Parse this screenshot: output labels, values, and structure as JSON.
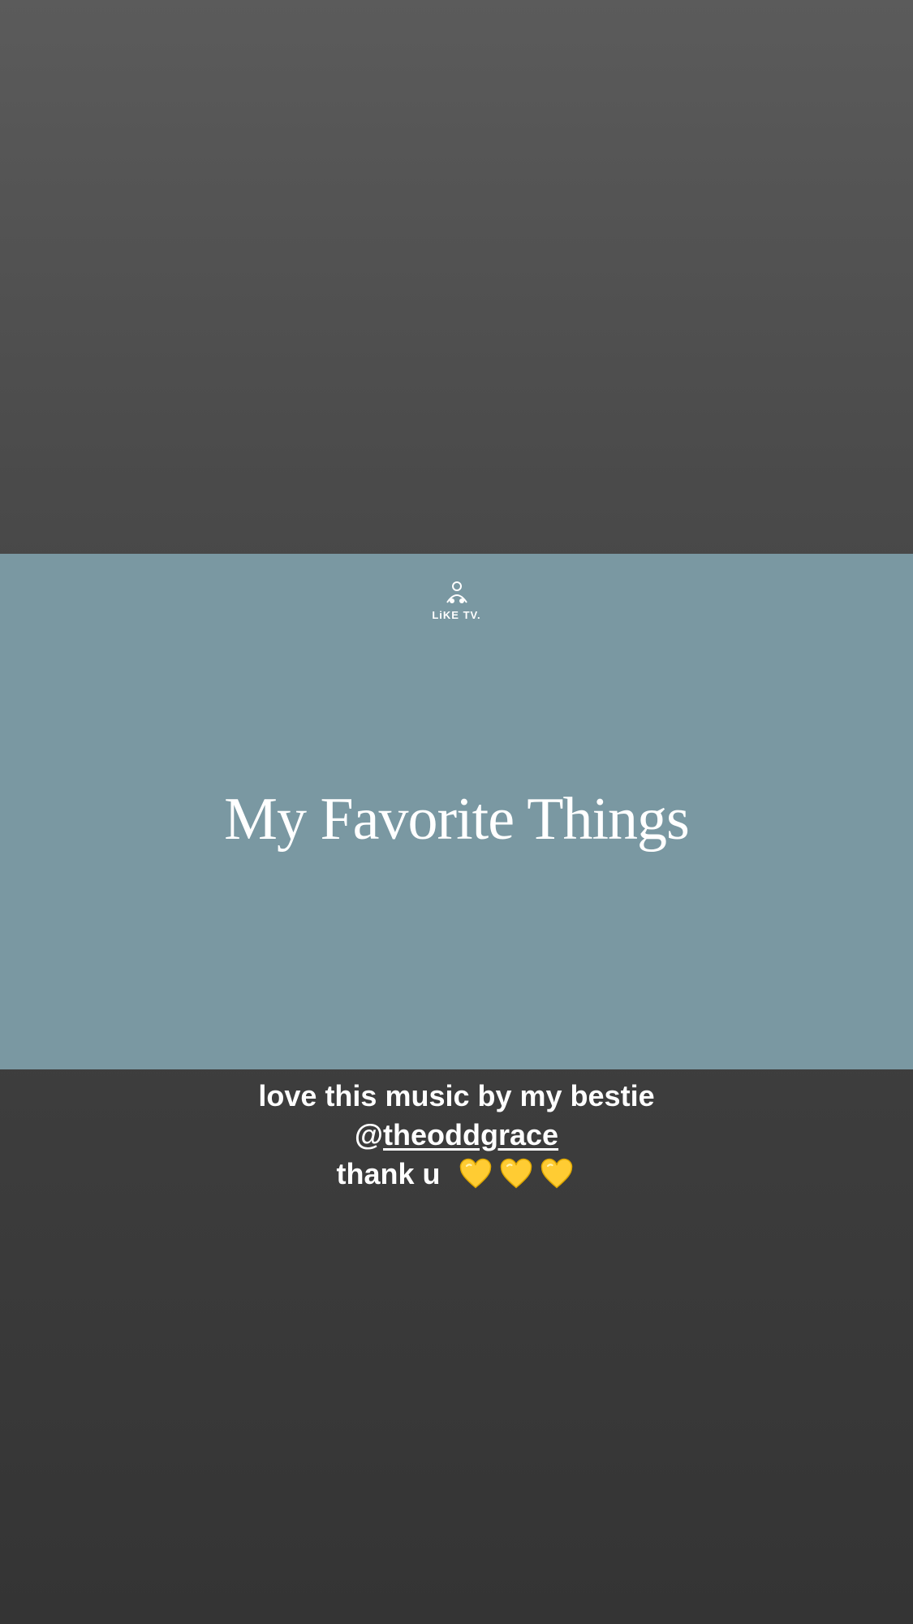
{
  "video": {
    "logo_text": "LiKE TV.",
    "title": "My Favorite Things"
  },
  "caption": {
    "line1": "love this music by my bestie",
    "mention_prefix": "@",
    "mention_handle": "theoddgrace",
    "line3_text": "thank u",
    "emoji": [
      "yellow-heart",
      "yellow-heart",
      "yellow-heart"
    ]
  },
  "colors": {
    "frame_bg": "#7a98a2",
    "heart": "#ffcc33"
  }
}
